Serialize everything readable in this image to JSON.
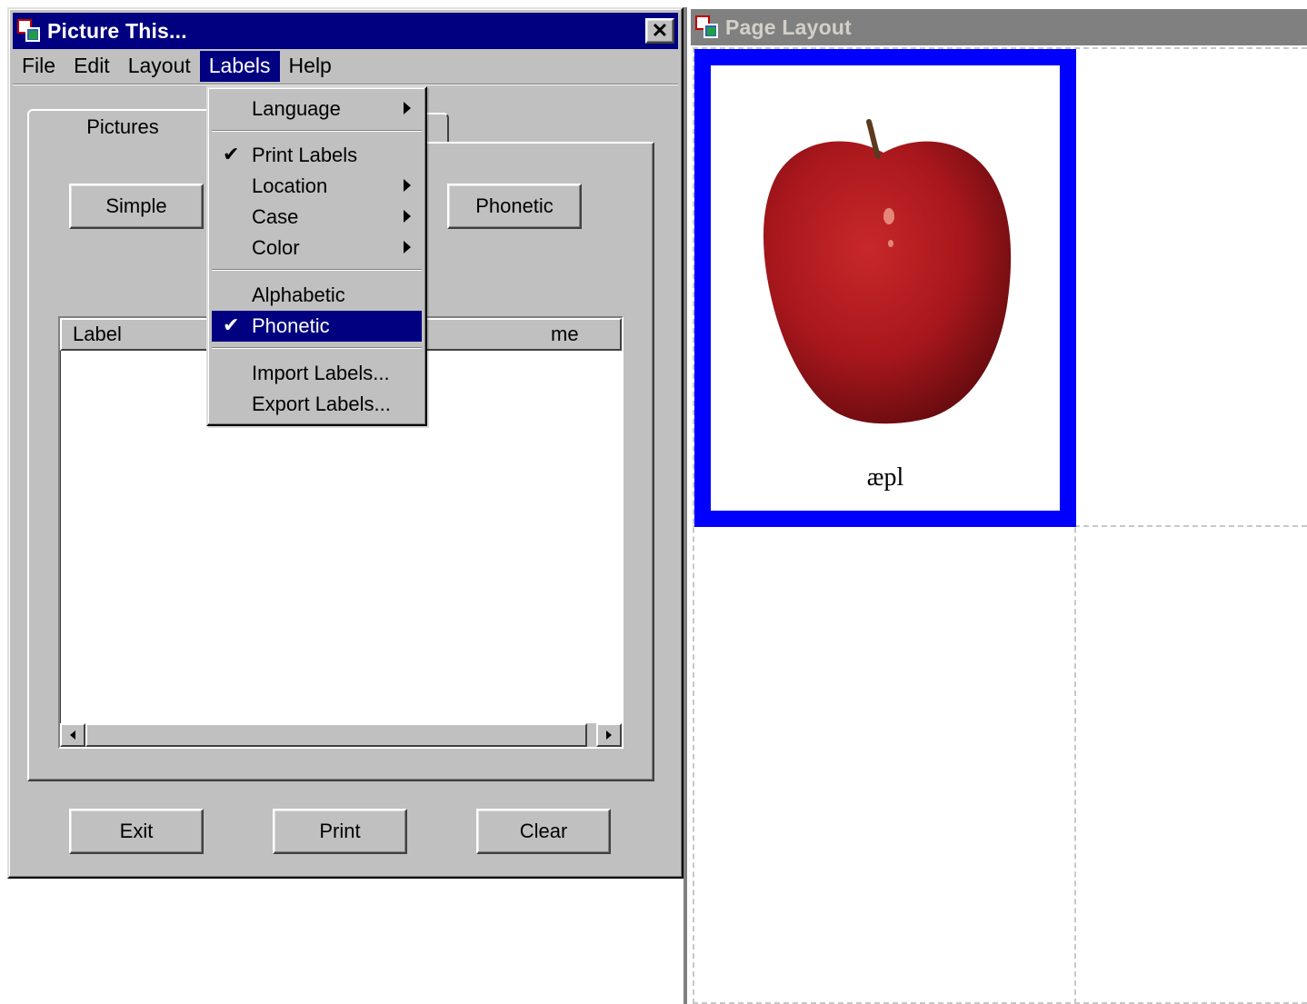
{
  "main_window": {
    "title": "Picture This...",
    "close_glyph": "✕",
    "menu": {
      "file": "File",
      "edit": "Edit",
      "layout": "Layout",
      "labels": "Labels",
      "help": "Help"
    },
    "tabs": {
      "pictures": "Pictures"
    },
    "buttons": {
      "simple": "Simple",
      "phonetic": "Phonetic",
      "exit": "Exit",
      "print": "Print",
      "clear": "Clear"
    },
    "list": {
      "columns": [
        "Label",
        "me"
      ]
    }
  },
  "labels_menu": {
    "items": [
      {
        "label": "Language",
        "checked": false,
        "submenu": true
      },
      {
        "label": "Print Labels",
        "checked": true,
        "submenu": false
      },
      {
        "label": "Location",
        "checked": false,
        "submenu": true
      },
      {
        "label": "Case",
        "checked": false,
        "submenu": true
      },
      {
        "label": "Color",
        "checked": false,
        "submenu": true
      },
      {
        "label": "Alphabetic",
        "checked": false,
        "submenu": false
      },
      {
        "label": "Phonetic",
        "checked": true,
        "submenu": false,
        "highlighted": true
      },
      {
        "label": "Import Labels...",
        "checked": false,
        "submenu": false
      },
      {
        "label": "Export Labels...",
        "checked": false,
        "submenu": false
      }
    ],
    "check_glyph": "✔"
  },
  "page_layout_window": {
    "title": "Page Layout",
    "card": {
      "picture": "red-apple",
      "label": "æpl",
      "border_color": "#0000ff"
    }
  },
  "colors": {
    "titlebar_active": "#000080",
    "titlebar_inactive": "#808080",
    "face": "#c0c0c0"
  }
}
